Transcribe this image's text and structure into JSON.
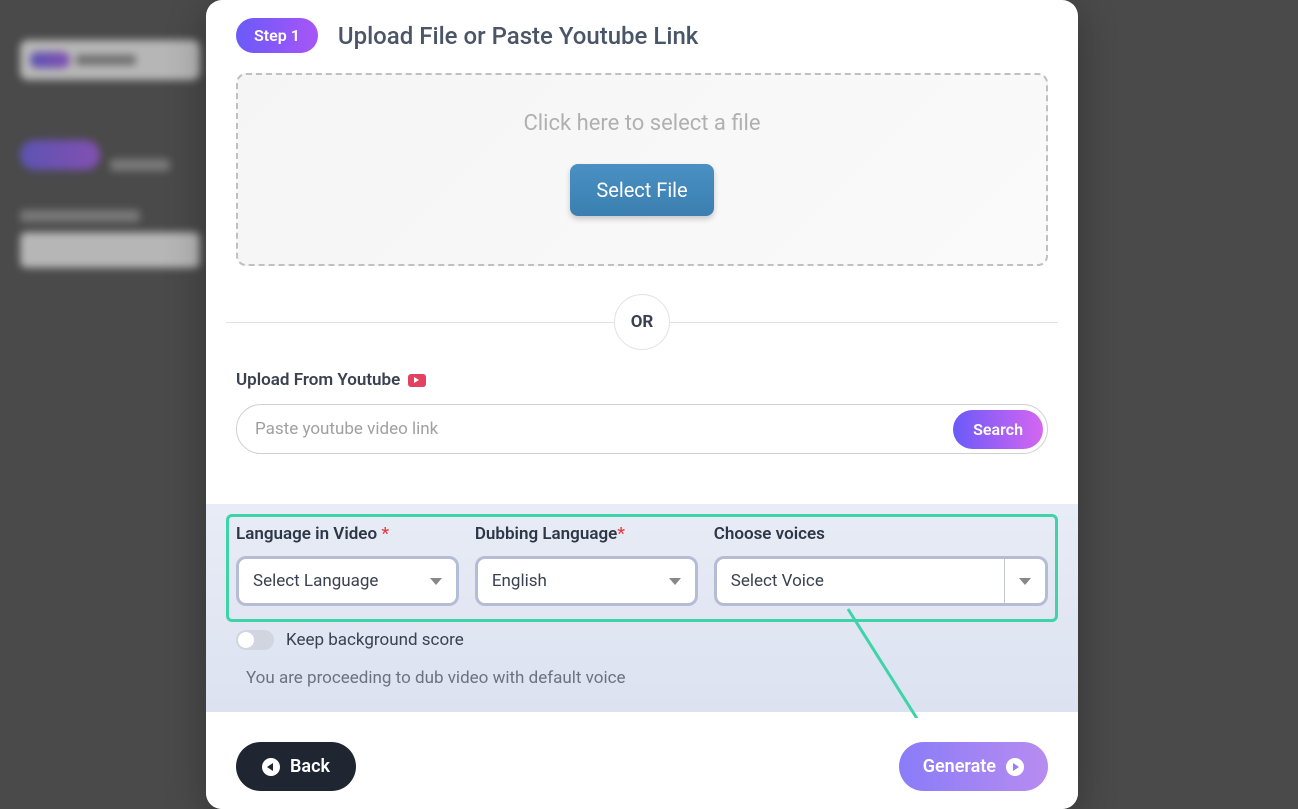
{
  "step": {
    "badge": "Step 1",
    "title": "Upload File or Paste Youtube Link"
  },
  "dropzone": {
    "hint": "Click here to select a file",
    "button": "Select File"
  },
  "divider": {
    "or": "OR"
  },
  "youtube": {
    "label": "Upload From Youtube",
    "placeholder": "Paste youtube video link",
    "search": "Search"
  },
  "lang": {
    "source_label": "Language in Video ",
    "source_value": "Select Language",
    "dub_label": "Dubbing Language",
    "dub_value": "English",
    "voice_label": "Choose voices",
    "voice_value": "Select Voice",
    "required": "*"
  },
  "toggle": {
    "label": "Keep background score"
  },
  "notice": "You are proceeding to dub video with default voice",
  "footer": {
    "back": "Back",
    "generate": "Generate"
  }
}
